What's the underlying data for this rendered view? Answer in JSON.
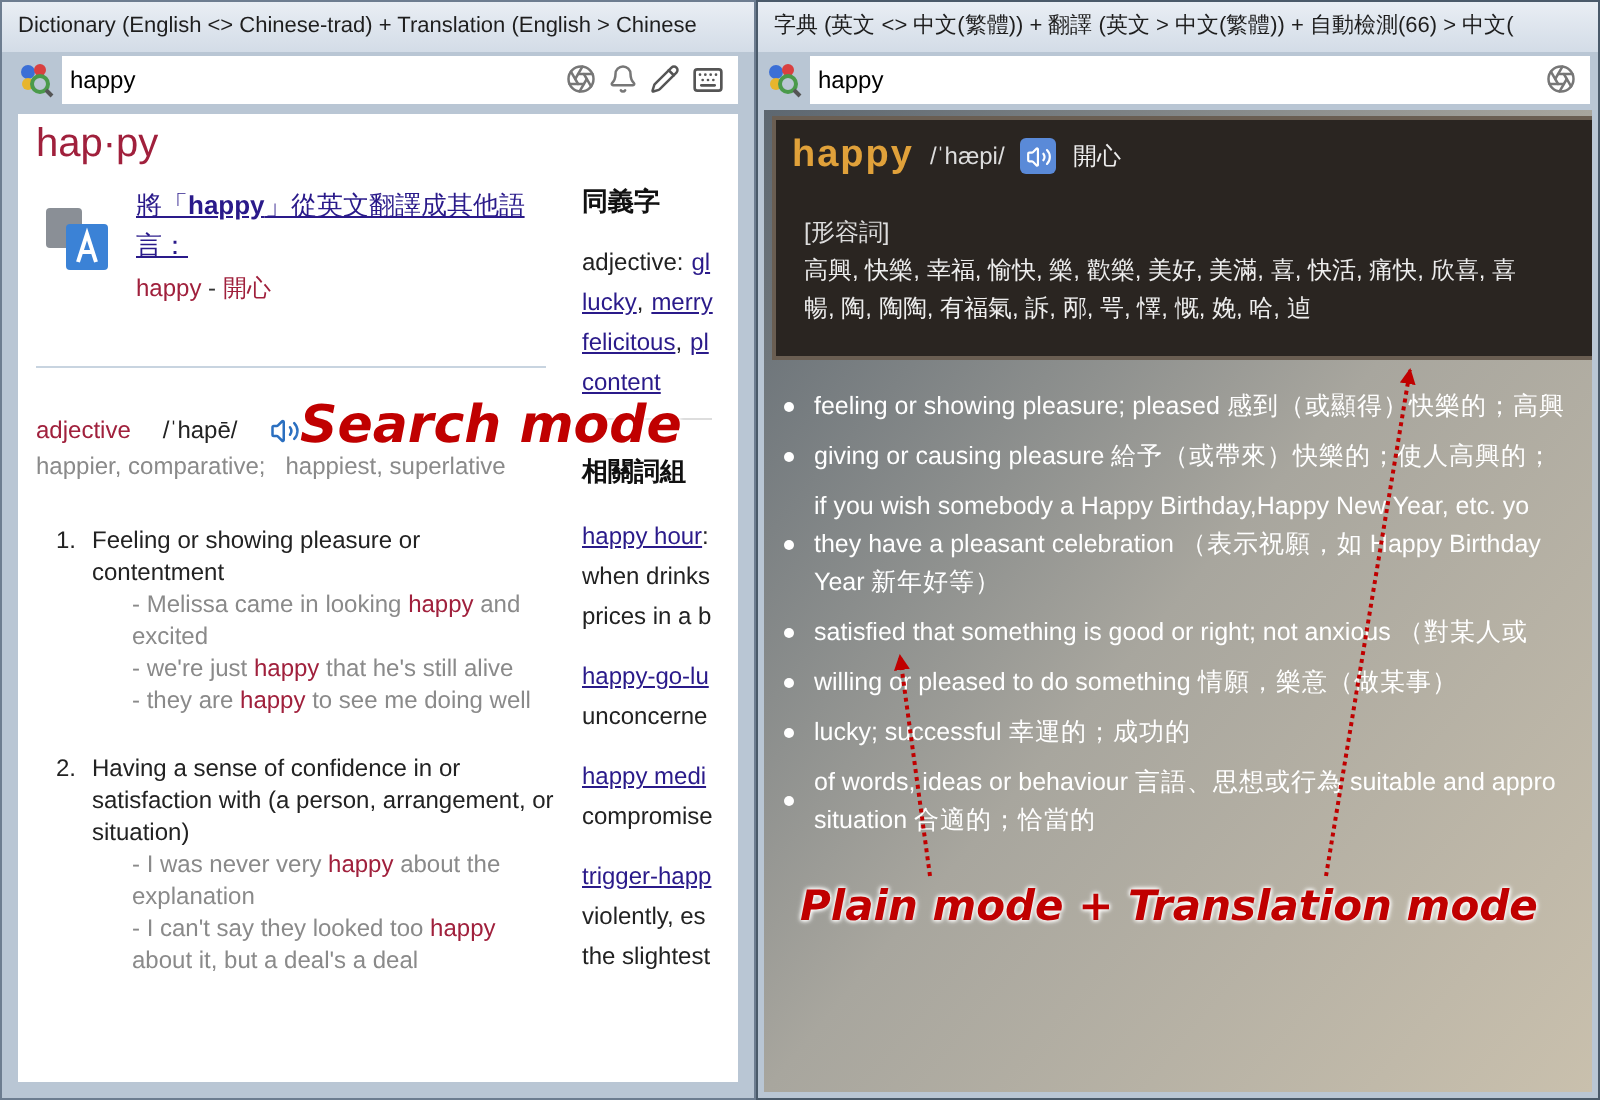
{
  "search_window": {
    "title": "Dictionary (English <> Chinese-trad) + Translation (English > Chinese",
    "search_value": "happy",
    "headword": "hap·py",
    "translate_link": "將「**happy**」從英文翻譯成其他語言：",
    "translation": {
      "word": "happy",
      "separator": "-",
      "meaning": "開心"
    },
    "part_of_speech": "adjective",
    "pronunciation": "/ˈhapē/",
    "forms": "happier, comparative;   happiest, superlative",
    "definitions": [
      {
        "number": "1.",
        "text": "Feeling or showing pleasure or contentment",
        "examples": [
          {
            "before": "- Melissa came in looking ",
            "highlight": "happy",
            "after": " and excited"
          },
          {
            "before": "- we're just ",
            "highlight": "happy",
            "after": " that he's still alive"
          },
          {
            "before": "- they are ",
            "highlight": "happy",
            "after": " to see me doing well"
          }
        ]
      },
      {
        "number": "2.",
        "text": "Having a sense of confidence in or satisfaction with (a person, arrangement, or situation)",
        "examples": [
          {
            "before": "- I was never very ",
            "highlight": "happy",
            "after": " about the explanation"
          },
          {
            "before": "- I can't say they looked too ",
            "highlight": "happy",
            "after": " about it, but a deal's a deal"
          }
        ]
      }
    ],
    "synonyms": {
      "heading": "同義字",
      "label": "adjective:",
      "separator": ",",
      "lines": [
        [
          "gl"
        ],
        [
          "lucky",
          "merry"
        ],
        [
          "felicitous",
          "pl"
        ],
        [
          "content"
        ]
      ]
    },
    "related": {
      "heading": "相關詞組",
      "phrases": [
        {
          "phrase": "happy hour",
          "suffix": ":",
          "lines": [
            "when drinks",
            "prices in a b"
          ]
        },
        {
          "phrase": "happy-go-lu",
          "lines": [
            "unconcerne"
          ]
        },
        {
          "phrase": "happy medi",
          "lines": [
            "compromise"
          ]
        },
        {
          "phrase": "trigger-happ",
          "lines": [
            "violently, es",
            "the slightest"
          ]
        }
      ]
    }
  },
  "plain_window": {
    "title": "字典 (英文 <> 中文(繁體)) + 翻譯 (英文 > 中文(繁體)) + 自動檢測(66) > 中文(",
    "search_value": "happy",
    "entry": {
      "word": "happy",
      "pronunciation": "/ˈhæpi/",
      "translation": "開心",
      "pos": "[形容詞]",
      "synonym_lines": [
        "高興, 快樂, 幸福, 愉快, 樂, 歡樂, 美好, 美滿, 喜, 快活, 痛快, 欣喜, 喜",
        "暢, 陶, 陶陶, 有福氣, 訴, 邴, 咢, 懌, 慨, 娩, 哈, 逌"
      ]
    },
    "senses": [
      {
        "lines": [
          "feeling or showing pleasure; pleased 感到（或顯得）快樂的；高興"
        ]
      },
      {
        "lines": [
          "giving or causing pleasure 給予（或帶來）快樂的；使人高興的；"
        ]
      },
      {
        "lines": [
          "if you wish somebody a Happy Birthday,Happy New Year, etc. yo",
          "they have a pleasant celebration （表示祝願，如 Happy Birthday",
          "Year 新年好等）"
        ]
      },
      {
        "lines": [
          "satisfied that something is good or right; not anxious （對某人或"
        ]
      },
      {
        "lines": [
          "willing or pleased to do something 情願，樂意（做某事）"
        ]
      },
      {
        "lines": [
          "lucky; successful 幸運的；成功的"
        ]
      },
      {
        "lines": [
          "of words, ideas or behaviour 言語、思想或行為 suitable and appro",
          "situation 合適的；恰當的"
        ]
      }
    ]
  },
  "annotations": [
    {
      "kind": "search",
      "text": "Search mode"
    },
    {
      "kind": "plain",
      "text": "Plain mode + Translation mode"
    }
  ]
}
